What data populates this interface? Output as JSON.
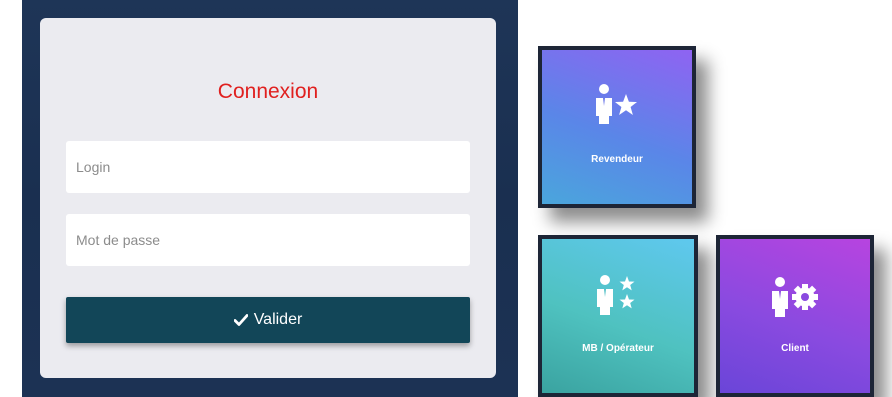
{
  "login": {
    "title": "Connexion",
    "login_placeholder": "Login",
    "password_placeholder": "Mot de passe",
    "submit_label": "Valider",
    "title_color": "#e0201f",
    "button_color": "#124658"
  },
  "tiles": [
    {
      "label": "Revendeur",
      "icon": "person-star-icon"
    },
    {
      "label": "MB / Opérateur",
      "icon": "person-stars-icon"
    },
    {
      "label": "Client",
      "icon": "person-gear-icon"
    }
  ]
}
